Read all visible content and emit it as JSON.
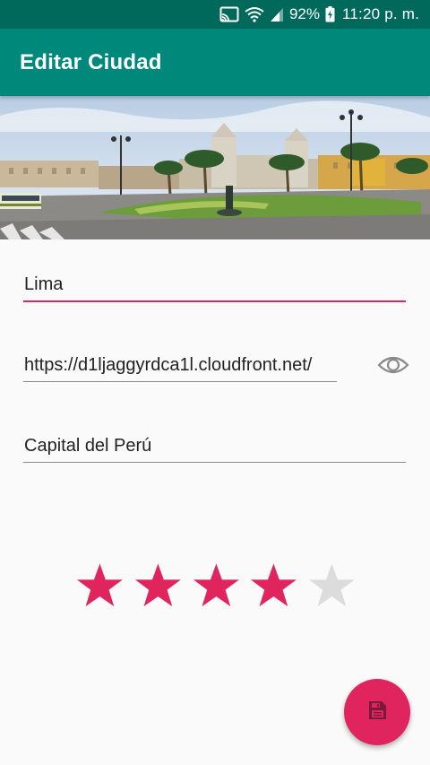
{
  "status_bar": {
    "battery": "92%",
    "time": "11:20 p. m.",
    "icons": [
      "cast-icon",
      "wifi-icon",
      "signal-icon",
      "battery-icon"
    ]
  },
  "app_bar": {
    "title": "Editar Ciudad"
  },
  "hero": {
    "image": "plaza-photo"
  },
  "form": {
    "city_name": "Lima",
    "image_url": "https://d1ljaggyrdca1l.cloudfront.net/",
    "description": "Capital del Perú"
  },
  "rating": {
    "value": 4,
    "max": 5
  },
  "fab": {
    "icon": "save-icon"
  },
  "colors": {
    "status_bar": "#00695c",
    "primary": "#00897b",
    "accent": "#e0245e",
    "star_empty": "#dcdcdc",
    "background": "#fafafa"
  }
}
